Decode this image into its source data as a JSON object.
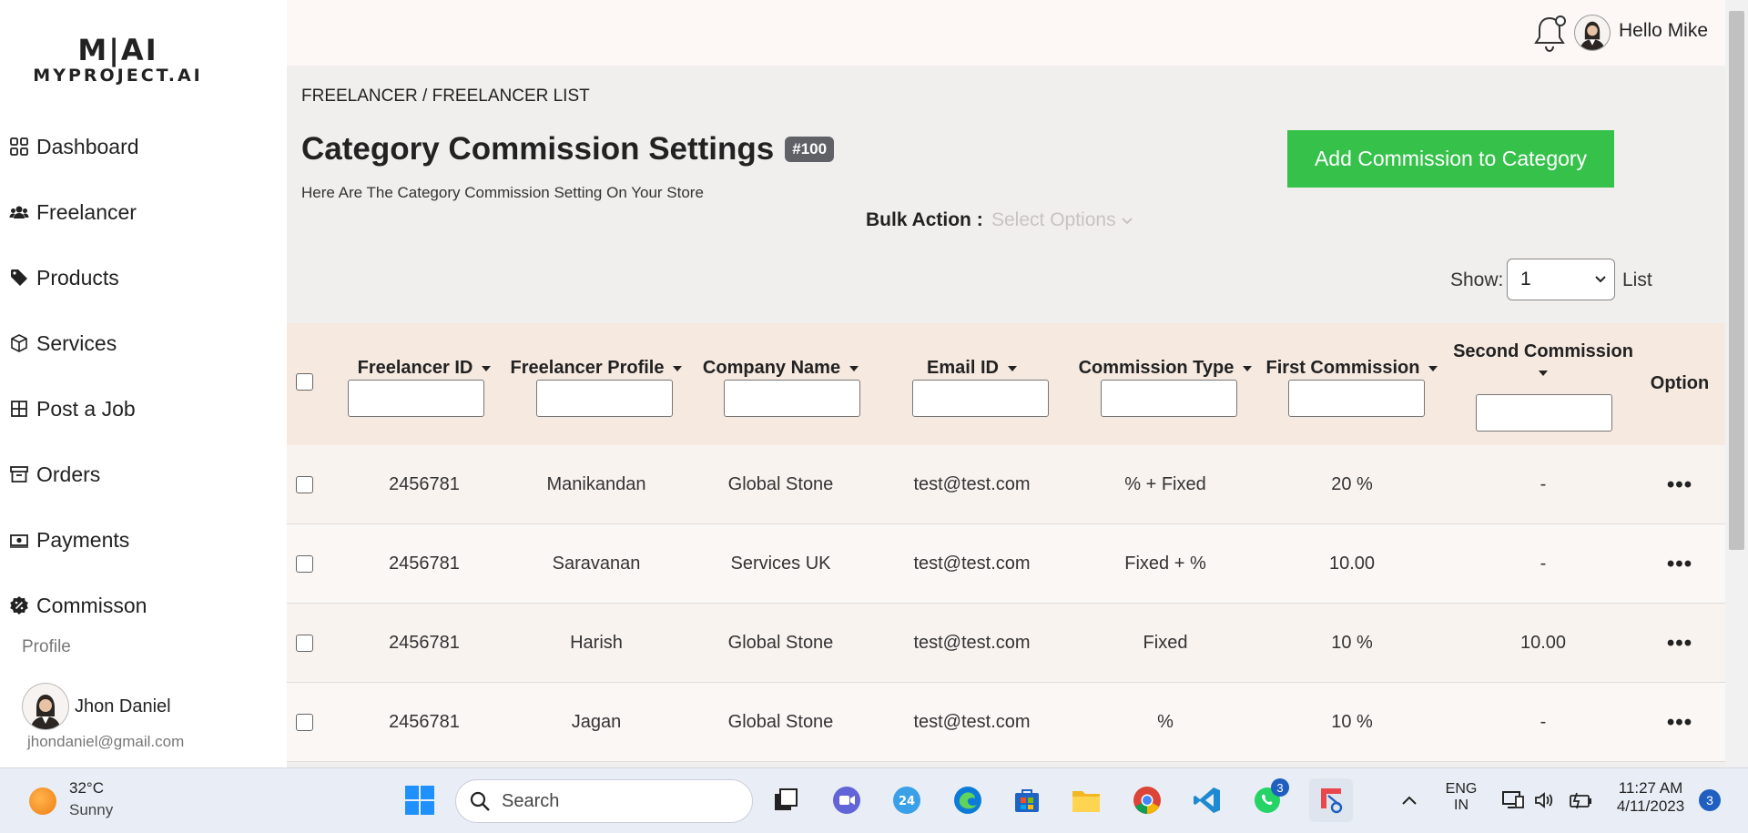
{
  "sidebar": {
    "logo_mark": "M|AI",
    "logo_text": "MYPROJECT.AI",
    "items": [
      {
        "label": "Dashboard",
        "icon": "dashboard-icon"
      },
      {
        "label": "Freelancer",
        "icon": "users-icon"
      },
      {
        "label": "Products",
        "icon": "tag-icon"
      },
      {
        "label": "Services",
        "icon": "box-icon"
      },
      {
        "label": "Post a Job",
        "icon": "grid-plus-icon"
      },
      {
        "label": "Orders",
        "icon": "archive-icon"
      },
      {
        "label": "Payments",
        "icon": "money-icon"
      },
      {
        "label": "Commisson",
        "icon": "percent-badge-icon"
      }
    ],
    "profile_label": "Profile",
    "user_name": "Jhon Daniel",
    "user_email": "jhondaniel@gmail.com"
  },
  "header": {
    "greeting": "Hello Mike"
  },
  "page": {
    "breadcrumb": "FREELANCER / FREELANCER LIST",
    "title": "Category Commission Settings",
    "badge": "#100",
    "subtitle": "Here Are The Category Commission Setting On Your Store",
    "add_button": "Add Commission to Category",
    "bulk_action_label": "Bulk Action :",
    "bulk_action_placeholder": "Select Options",
    "show_label": "Show:",
    "show_value": "1",
    "list_label": "List"
  },
  "table": {
    "columns": [
      "Freelancer ID",
      "Freelancer Profile",
      "Company Name",
      "Email ID",
      "Commission Type",
      "First Commission",
      "Second Commission",
      "Option"
    ],
    "rows": [
      {
        "id": "2456781",
        "profile": "Manikandan",
        "company": "Global Stone",
        "email": "test@test.com",
        "type": "% + Fixed",
        "first": "20 %",
        "second": "-",
        "option": "•••"
      },
      {
        "id": "2456781",
        "profile": "Saravanan",
        "company": "Services UK",
        "email": "test@test.com",
        "type": "Fixed + %",
        "first": "10.00",
        "second": "-",
        "option": "•••"
      },
      {
        "id": "2456781",
        "profile": "Harish",
        "company": "Global Stone",
        "email": "test@test.com",
        "type": "Fixed",
        "first": "10 %",
        "second": "10.00",
        "option": "•••"
      },
      {
        "id": "2456781",
        "profile": "Jagan",
        "company": "Global Stone",
        "email": "test@test.com",
        "type": "%",
        "first": "10 %",
        "second": "-",
        "option": "•••"
      }
    ]
  },
  "taskbar": {
    "temperature": "32°C",
    "condition": "Sunny",
    "search_placeholder": "Search",
    "lang_top": "ENG",
    "lang_bottom": "IN",
    "time": "11:27 AM",
    "date": "4/11/2023",
    "notification_count": "3",
    "whatsapp_badge": "3",
    "calendar_day": "24"
  },
  "colors": {
    "accent_green": "#35c14a",
    "header_row": "#f6e9e0",
    "badge": "#5f6166"
  }
}
